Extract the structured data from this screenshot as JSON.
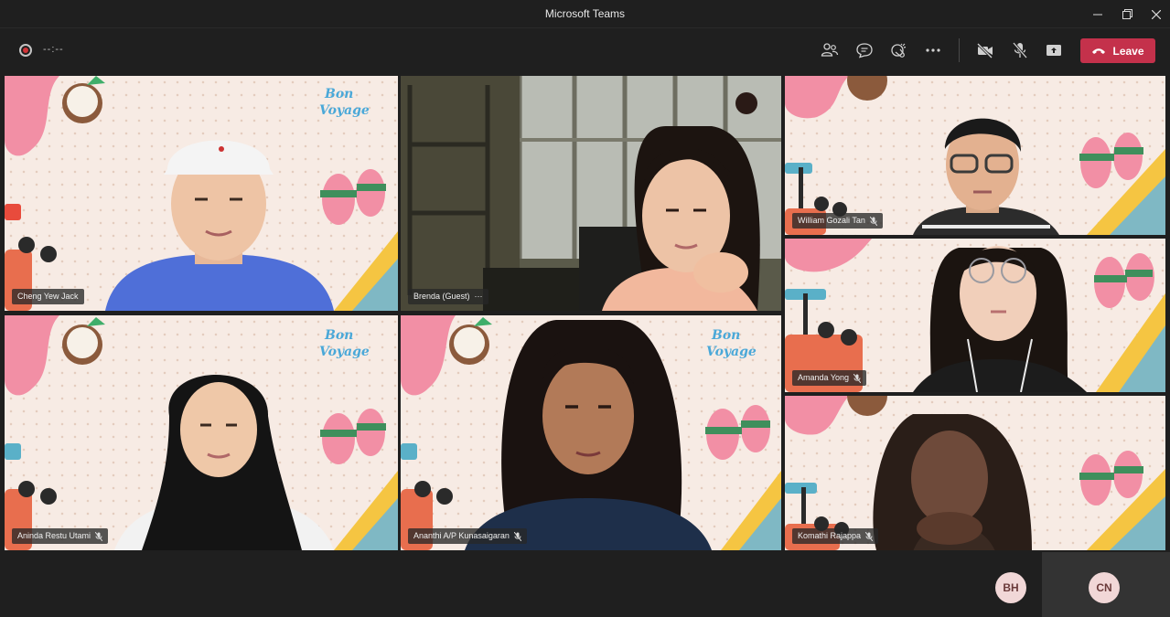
{
  "window": {
    "title": "Microsoft Teams",
    "minimize_icon": "minimize-icon",
    "maximize_icon": "restore-icon",
    "close_icon": "close-icon"
  },
  "toolbar": {
    "timer": "--:--",
    "leave_label": "Leave",
    "accent_color": "#c4314b",
    "icons": [
      "participants-icon",
      "chat-icon",
      "reactions-icon",
      "more-icon",
      "camera-off-icon",
      "mic-off-icon",
      "share-icon",
      "phone-hangup-icon"
    ]
  },
  "participants": [
    {
      "name": "Cheng Yew Jack",
      "muted": false
    },
    {
      "name": "Brenda (Guest)",
      "more": "···"
    },
    {
      "name": "William Gozali Tan",
      "muted": true
    },
    {
      "name": "Amanda Yong",
      "muted": true
    },
    {
      "name": "Aninda Restu Utami",
      "muted": true
    },
    {
      "name": "Ananthi A/P Kunasaigaran",
      "muted": true
    },
    {
      "name": "Komathi Rajappa",
      "muted": true
    }
  ],
  "bottom": {
    "avatar_1": "BH",
    "avatar_2": "CN"
  },
  "background": {
    "banner_text": "Bon Voyage"
  }
}
